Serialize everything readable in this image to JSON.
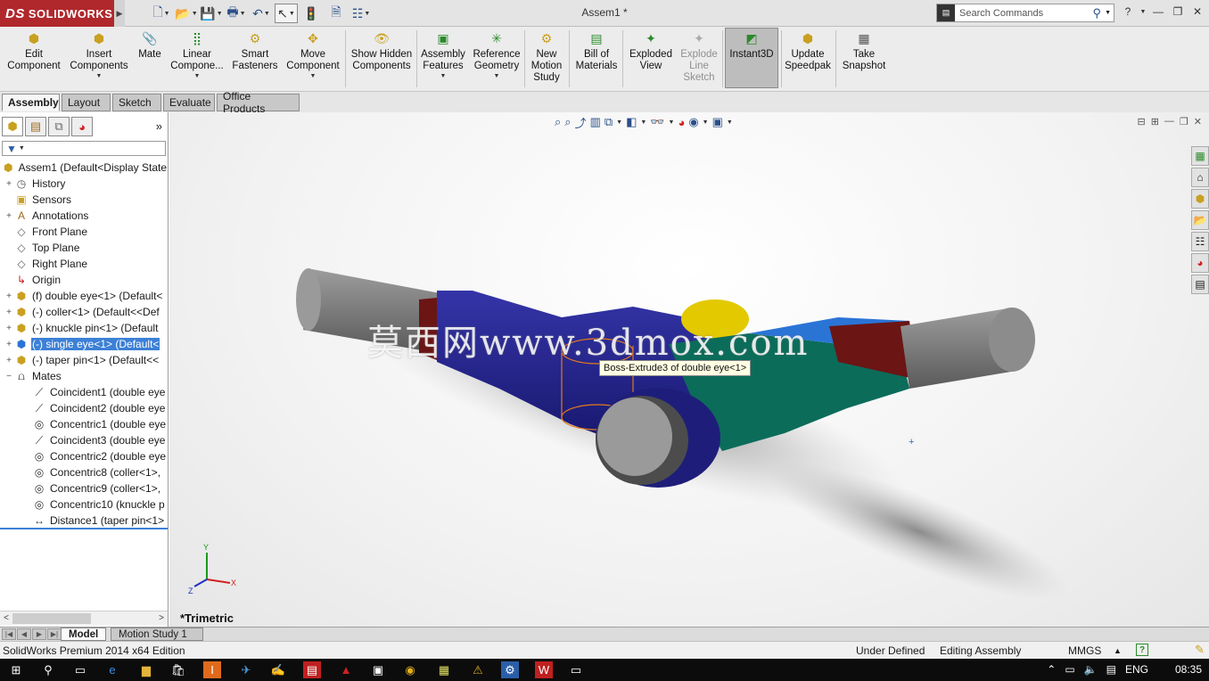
{
  "app": {
    "logo_text": "SOLIDWORKS",
    "logo_prefix": "DS",
    "document_title": "Assem1 *"
  },
  "search": {
    "placeholder": "Search Commands"
  },
  "command_manager": [
    {
      "label": "Edit Component",
      "icon": "edit-component-icon",
      "has_dropdown": false
    },
    {
      "label": "Insert Components",
      "icon": "insert-components-icon",
      "has_dropdown": true
    },
    {
      "label": "Mate",
      "icon": "mate-icon",
      "has_dropdown": false
    },
    {
      "label": "Linear Compone...",
      "icon": "linear-pattern-icon",
      "has_dropdown": true
    },
    {
      "label": "Smart Fasteners",
      "icon": "smart-fasteners-icon",
      "has_dropdown": false
    },
    {
      "label": "Move Component",
      "icon": "move-component-icon",
      "has_dropdown": true
    },
    {
      "label": "Show Hidden Components",
      "icon": "show-hidden-icon",
      "has_dropdown": false
    },
    {
      "label": "Assembly Features",
      "icon": "assembly-features-icon",
      "has_dropdown": true
    },
    {
      "label": "Reference Geometry",
      "icon": "reference-geometry-icon",
      "has_dropdown": true
    },
    {
      "label": "New Motion Study",
      "icon": "motion-study-icon",
      "has_dropdown": false
    },
    {
      "label": "Bill of Materials",
      "icon": "bill-of-materials-icon",
      "has_dropdown": false
    },
    {
      "label": "Exploded View",
      "icon": "exploded-view-icon",
      "has_dropdown": false
    },
    {
      "label": "Explode Line Sketch",
      "icon": "explode-line-icon",
      "has_dropdown": false,
      "disabled": true
    },
    {
      "label": "Instant3D",
      "icon": "instant3d-icon",
      "has_dropdown": false,
      "active": true
    },
    {
      "label": "Update Speedpak",
      "icon": "speedpak-icon",
      "has_dropdown": false
    },
    {
      "label": "Take Snapshot",
      "icon": "snapshot-icon",
      "has_dropdown": false
    }
  ],
  "tabs": [
    "Assembly",
    "Layout",
    "Sketch",
    "Evaluate",
    "Office Products"
  ],
  "active_tab": "Assembly",
  "feature_tree": [
    {
      "label": "Assem1  (Default<Display State",
      "type": "assembly",
      "expander": "",
      "indent": 0
    },
    {
      "label": "History",
      "type": "history",
      "expander": "+",
      "indent": 1
    },
    {
      "label": "Sensors",
      "type": "sensors",
      "expander": "",
      "indent": 1
    },
    {
      "label": "Annotations",
      "type": "annotations",
      "expander": "+",
      "indent": 1
    },
    {
      "label": "Front Plane",
      "type": "plane",
      "expander": "",
      "indent": 1
    },
    {
      "label": "Top Plane",
      "type": "plane",
      "expander": "",
      "indent": 1
    },
    {
      "label": "Right Plane",
      "type": "plane",
      "expander": "",
      "indent": 1
    },
    {
      "label": "Origin",
      "type": "origin",
      "expander": "",
      "indent": 1
    },
    {
      "label": "(f) double eye<1> (Default<",
      "type": "part",
      "expander": "+",
      "indent": 1
    },
    {
      "label": "(-) coller<1> (Default<<Def",
      "type": "part",
      "expander": "+",
      "indent": 1
    },
    {
      "label": "(-) knuckle pin<1> (Default",
      "type": "part",
      "expander": "+",
      "indent": 1
    },
    {
      "label": "(-) single eye<1> (Default<",
      "type": "part",
      "expander": "+",
      "indent": 1,
      "selected": true
    },
    {
      "label": "(-) taper pin<1> (Default<<",
      "type": "part",
      "expander": "+",
      "indent": 1
    },
    {
      "label": "Mates",
      "type": "mates",
      "expander": "−",
      "indent": 1
    },
    {
      "label": "Coincident1 (double eye",
      "type": "coincident",
      "expander": "",
      "indent": 2
    },
    {
      "label": "Coincident2 (double eye",
      "type": "coincident",
      "expander": "",
      "indent": 2
    },
    {
      "label": "Concentric1 (double eye",
      "type": "concentric",
      "expander": "",
      "indent": 2
    },
    {
      "label": "Coincident3 (double eye",
      "type": "coincident",
      "expander": "",
      "indent": 2
    },
    {
      "label": "Concentric2 (double eye",
      "type": "concentric",
      "expander": "",
      "indent": 2
    },
    {
      "label": "Concentric8 (coller<1>,",
      "type": "concentric",
      "expander": "",
      "indent": 2
    },
    {
      "label": "Concentric9 (coller<1>,",
      "type": "concentric",
      "expander": "",
      "indent": 2
    },
    {
      "label": "Concentric10 (knuckle p",
      "type": "concentric",
      "expander": "",
      "indent": 2
    },
    {
      "label": "Distance1 (taper pin<1>",
      "type": "distance",
      "expander": "",
      "indent": 2
    }
  ],
  "viewport": {
    "tooltip": "Boss-Extrude3 of double eye<1>",
    "watermark": "莫西网www.3dmox.com",
    "view_orientation": "*Trimetric",
    "triad": {
      "x": "X",
      "y": "Y",
      "z": "Z"
    }
  },
  "bottom_tabs": [
    "Model",
    "Motion Study 1"
  ],
  "active_bottom_tab": "Model",
  "status": {
    "product": "SolidWorks Premium 2014 x64 Edition",
    "definition": "Under Defined",
    "mode": "Editing Assembly",
    "units": "MMGS",
    "units_arrow": "▲"
  },
  "taskbar": {
    "language": "ENG",
    "time": "08:35"
  },
  "colors": {
    "logo_red": "#b0282c",
    "selection_blue": "#3c80d6",
    "part_navy": "#23238a",
    "part_teal": "#0b6c5a",
    "part_maroon": "#6b1515",
    "pin_gray": "#8c8c8c"
  }
}
